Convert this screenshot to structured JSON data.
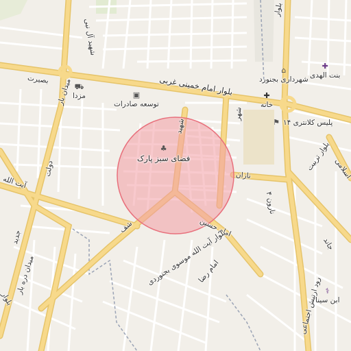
{
  "map": {
    "accent": {
      "circle_fill": "#f29ca4",
      "circle_stroke": "#e8707c",
      "major_road": "#f7d98b",
      "road_edge": "#e6c46a"
    },
    "streets": {
      "bolvar_top": "بلوار",
      "emam_khomeini": "بلوار امام خمینی غربی",
      "basirat": "بصیرت",
      "meydan_bar": "میدان بار",
      "shahid_al": "شهید آل نبی",
      "emam_hossein": "امام حسین",
      "nazan": "نازان",
      "dovlat": "دولت",
      "ayatollah": "آیت الله",
      "meydan_dare": "میدان دره بار",
      "jadid": "جدید",
      "mostafa": "شف",
      "bolvar_mousavi": "بلوار آیت الله موسوی بجنوردی",
      "emam_reza": "امام رضا",
      "bolvar_left": "بلوار",
      "tarbiat": "بلوار تربیت",
      "eslami": "اسلامی",
      "jand": "جاند",
      "rahe": "نارون ۴",
      "road_bottom": "رود ارتیش اجتماعی",
      "shahid": "شهید",
      "shahr": "شهر"
    },
    "pois": {
      "park": "فضای سبز پارک",
      "mazda": "مزدا",
      "tosee": "توسعه صادرات",
      "shahrdari": "شهرداری بجنورد",
      "binat": "بنت الهدی",
      "khane": "خانه",
      "police": "پلیس کلانتری ۱۴",
      "ebnsina": "ابن سینا"
    },
    "icons": {
      "park": "tree-icon",
      "mazda": "car-icon",
      "tosee": "bank-icon",
      "shahrdari": "museum-icon",
      "binat": "hospital-icon",
      "khane": "hospital-icon",
      "police": "police-icon",
      "ebnsina": "clinic-icon"
    }
  }
}
